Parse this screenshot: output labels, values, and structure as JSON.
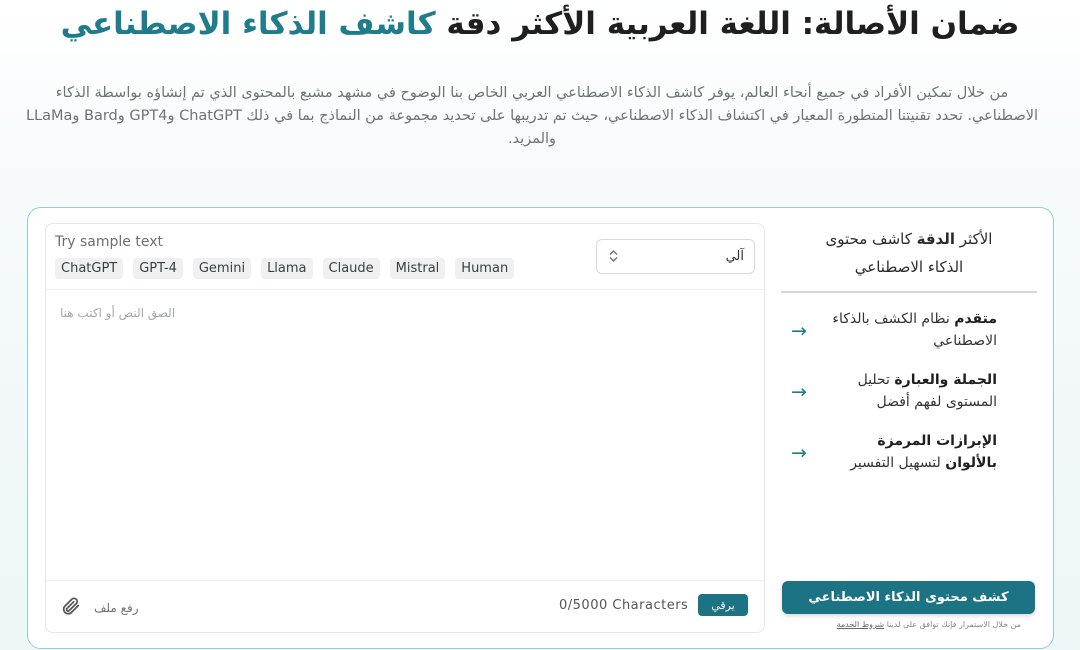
{
  "hero": {
    "title_main": "ضمان الأصالة: اللغة العربية الأكثر دقة",
    "title_accent": "كاشف الذكاء الاصطناعي",
    "description": "من خلال تمكين الأفراد في جميع أنحاء العالم، يوفر كاشف الذكاء الاصطناعي العربي الخاص بنا الوضوح في مشهد مشبع بالمحتوى الذي تم إنشاؤه بواسطة الذكاء الاصطناعي. تحدد تقنيتنا المتطورة المعيار في اكتشاف الذكاء الاصطناعي، حيث تم تدريبها على تحديد مجموعة من النماذج بما في ذلك ChatGPT وGPT4 وBard وLLaMa والمزيد."
  },
  "editor": {
    "sample_label": "Try sample text",
    "chips": [
      "ChatGPT",
      "GPT-4",
      "Gemini",
      "Llama",
      "Claude",
      "Mistral",
      "Human"
    ],
    "language_select": "آلي",
    "placeholder": "الصق النص أو اكتب هنا",
    "upload_label": "رفع ملف",
    "char_count": "0/5000 Characters",
    "upgrade_label": "يرقي"
  },
  "side": {
    "title_pre": "الأكثر",
    "title_bold": "الدقة",
    "title_post": "كاشف محتوى الذكاء الاصطناعي",
    "features": [
      {
        "bold": "متقدم",
        "rest": "نظام الكشف بالذكاء الاصطناعي"
      },
      {
        "bold": "الجملة والعبارة",
        "rest": "تحليل المستوى لفهم أفضل"
      },
      {
        "bold": "الإبرازات المرمزة بالألوان",
        "rest": "لتسهيل التفسير"
      }
    ],
    "detect_button": "كشف محتوى الذكاء الاصطناعي",
    "terms_text": "من خلال الاستمرار فإنك توافق على لدينا",
    "terms_link": "شروط الخدمة"
  },
  "colors": {
    "accent": "#1e7c8c",
    "button": "#1c7384",
    "card_border": "#8fd0d8"
  },
  "icons": {
    "upload": "paperclip-icon",
    "select": "chevron-updown-icon",
    "feature": "arrow-right-icon"
  }
}
